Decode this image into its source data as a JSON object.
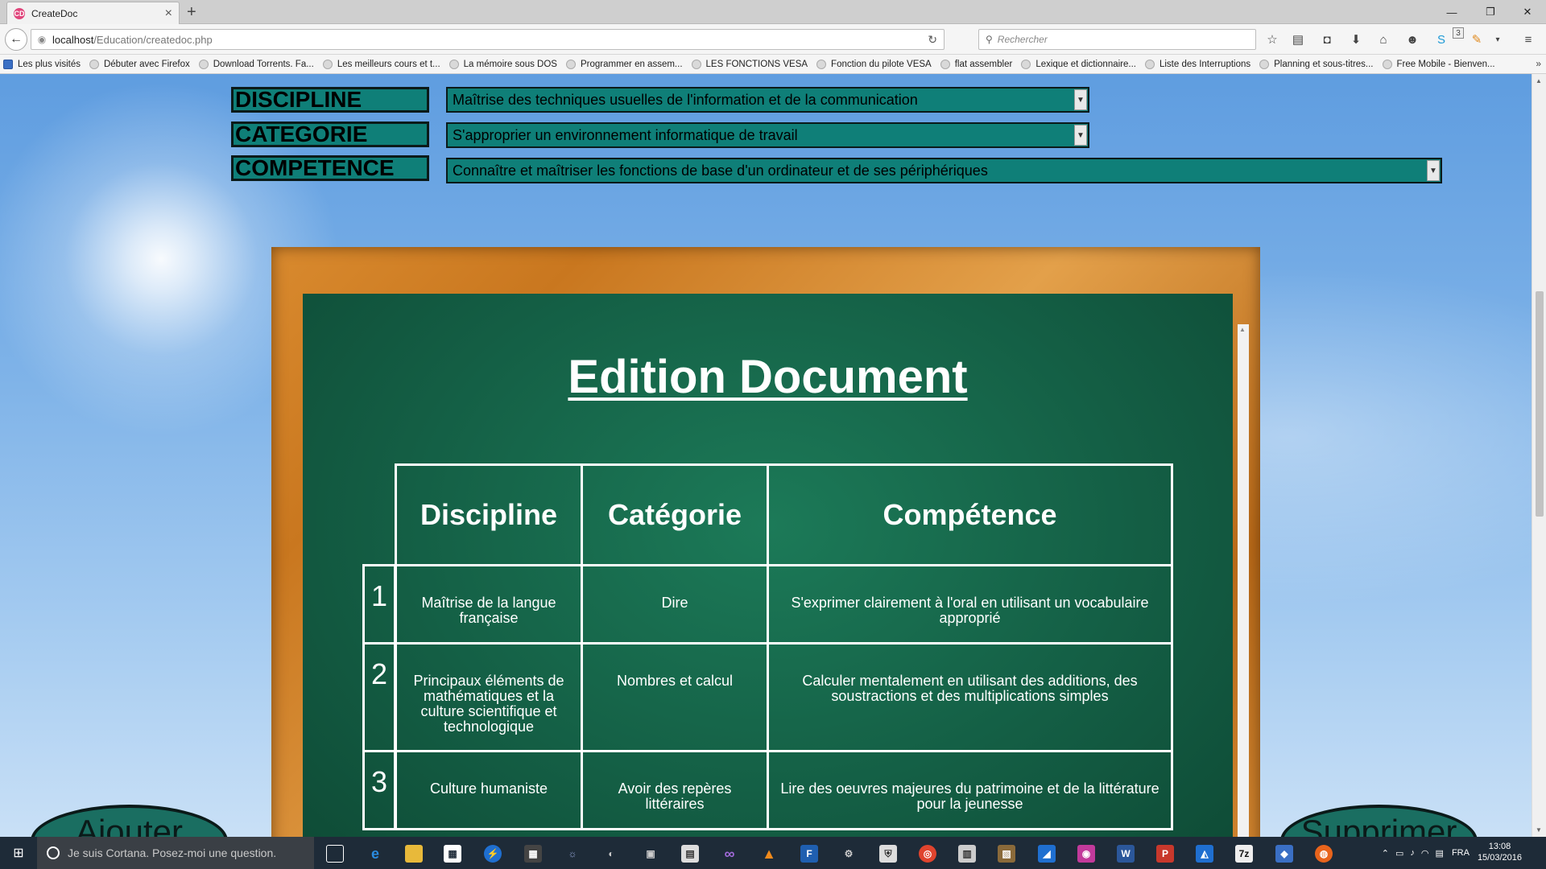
{
  "browser": {
    "tab_title": "CreateDoc",
    "tab_favicon": "CD",
    "url_host": "localhost",
    "url_path": "/Education/createdoc.php",
    "search_placeholder": "Rechercher",
    "notification_badge": "3",
    "bookmarks": [
      "Les plus visités",
      "Débuter avec Firefox",
      "Download Torrents. Fa...",
      "Les meilleurs cours et t...",
      "La mémoire sous DOS",
      "Programmer en assem...",
      "LES FONCTIONS VESA",
      "Fonction du pilote VESA",
      "flat assembler",
      "Lexique et dictionnaire...",
      "Liste des Interruptions",
      "Planning et sous-titres...",
      "Free Mobile - Bienven..."
    ],
    "nav_icons": [
      "back-icon",
      "reload-icon",
      "search-icon",
      "bookmark-star-icon",
      "reading-list-icon",
      "pocket-icon",
      "download-icon",
      "home-icon",
      "chat-icon",
      "skype-icon",
      "extension-icon",
      "menu-icon"
    ]
  },
  "filters": {
    "discipline_label": "DISCIPLINE",
    "categorie_label": "CATEGORIE",
    "competence_label": "COMPETENCE",
    "discipline_value": "Maîtrise des techniques usuelles de l'information et de la communication",
    "categorie_value": "S'approprier un environnement informatique de travail",
    "competence_value": "Connaître et maîtriser les fonctions de base d'un ordinateur et de ses périphériques"
  },
  "document": {
    "title": "Edition Document",
    "headers": [
      "Discipline",
      "Catégorie",
      "Compétence"
    ],
    "rows": [
      {
        "num": "1",
        "discipline": "Maîtrise de la langue française",
        "categorie": "Dire",
        "competence": "S'exprimer clairement à l'oral en utilisant un vocabulaire approprié"
      },
      {
        "num": "2",
        "discipline": "Principaux éléments de mathématiques et la culture scientifique et technologique",
        "categorie": "Nombres et calcul",
        "competence": "Calculer mentalement en utilisant des additions, des soustractions et des multiplications simples"
      },
      {
        "num": "3",
        "discipline": "Culture humaniste",
        "categorie": "Avoir des repères littéraires",
        "competence": "Lire des oeuvres majeures du patrimoine et de la littérature pour la jeunesse"
      }
    ]
  },
  "actions": {
    "add_label": "Ajouter",
    "delete_label": "Supprimer"
  },
  "taskbar": {
    "cortana_text": "Je suis Cortana. Posez-moi une question.",
    "language": "FRA",
    "time": "13:08",
    "date": "15/03/2016"
  }
}
